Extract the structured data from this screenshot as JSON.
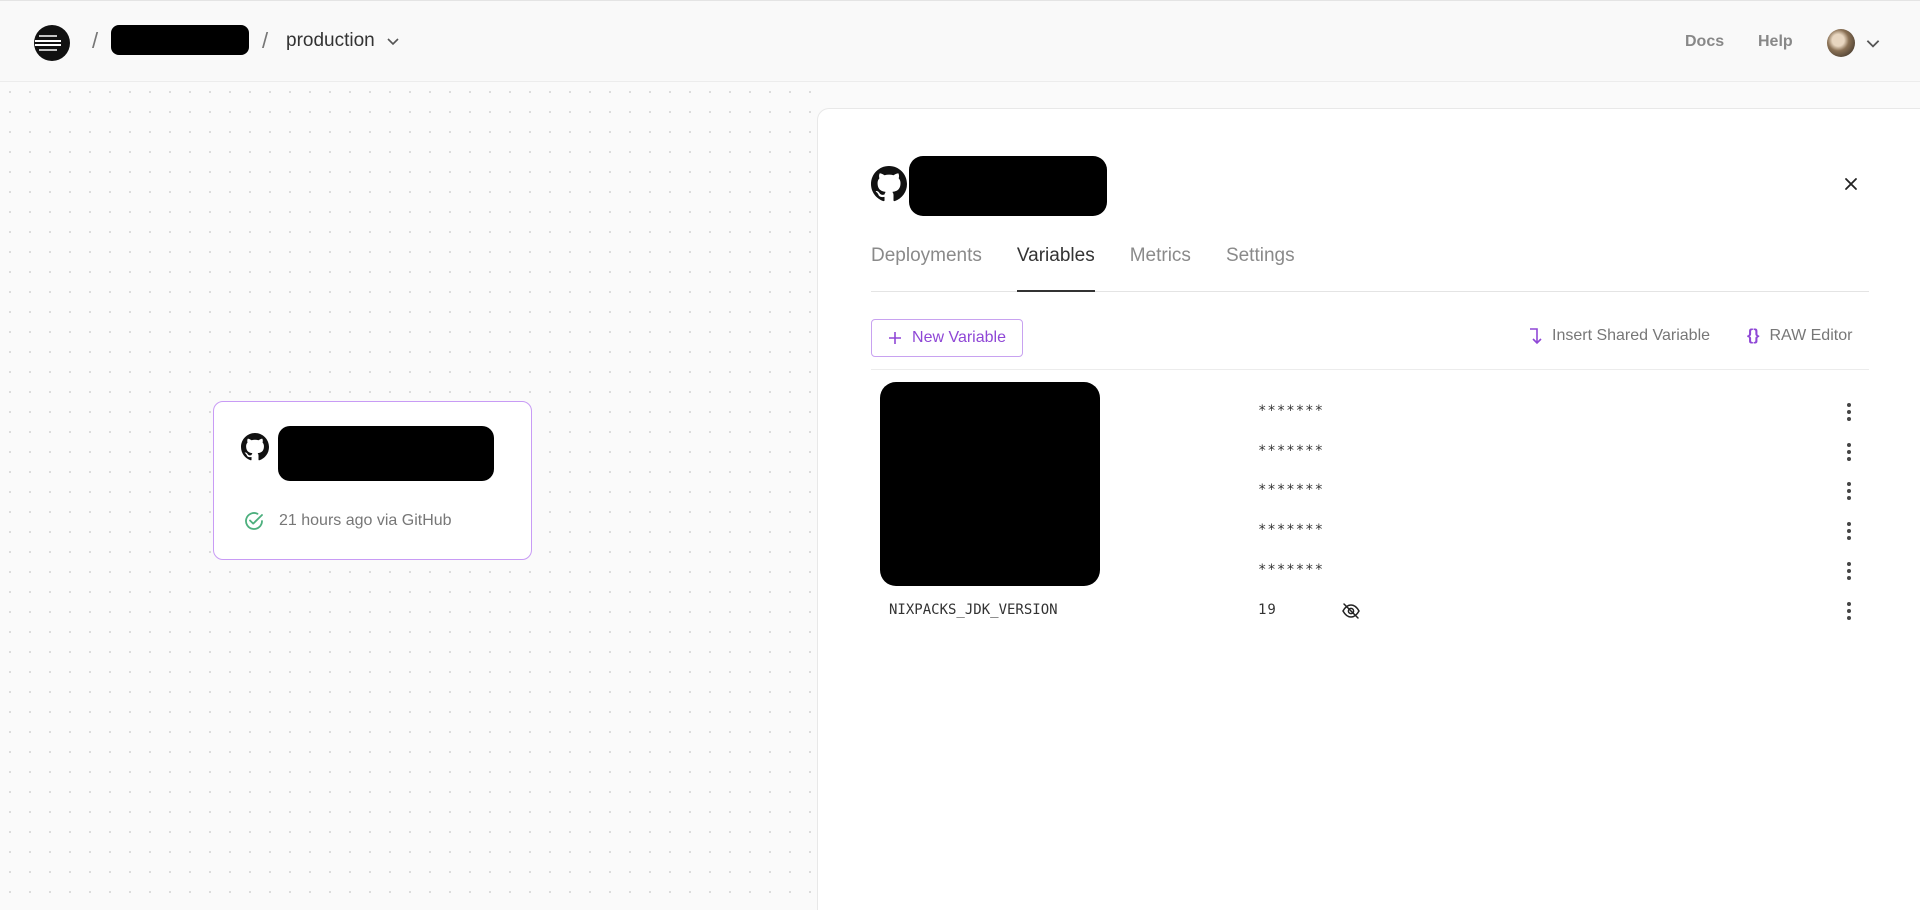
{
  "topbar": {
    "separator": "/",
    "environment": "production",
    "links": {
      "docs": "Docs",
      "help": "Help"
    }
  },
  "canvas": {
    "service_card": {
      "status_text": "21 hours ago via GitHub",
      "status_color": "#4caf7d",
      "border_color": "#c89bf5"
    }
  },
  "panel": {
    "tabs": [
      {
        "label": "Deployments",
        "active": false
      },
      {
        "label": "Variables",
        "active": true
      },
      {
        "label": "Metrics",
        "active": false
      },
      {
        "label": "Settings",
        "active": false
      }
    ],
    "actions": {
      "new_variable": "New Variable",
      "insert_shared": "Insert Shared Variable",
      "raw_editor": "RAW Editor",
      "raw_editor_icon": "{}",
      "accent_color": "#8f47d6"
    },
    "variables": [
      {
        "name": "",
        "value": "*******",
        "redacted_name": true
      },
      {
        "name": "",
        "value": "*******",
        "redacted_name": true
      },
      {
        "name": "",
        "value": "*******",
        "redacted_name": true
      },
      {
        "name": "",
        "value": "*******",
        "redacted_name": true
      },
      {
        "name": "",
        "value": "*******",
        "redacted_name": true
      },
      {
        "name": "NIXPACKS_JDK_VERSION",
        "value": "19",
        "redacted_name": false,
        "revealed": true
      }
    ]
  }
}
